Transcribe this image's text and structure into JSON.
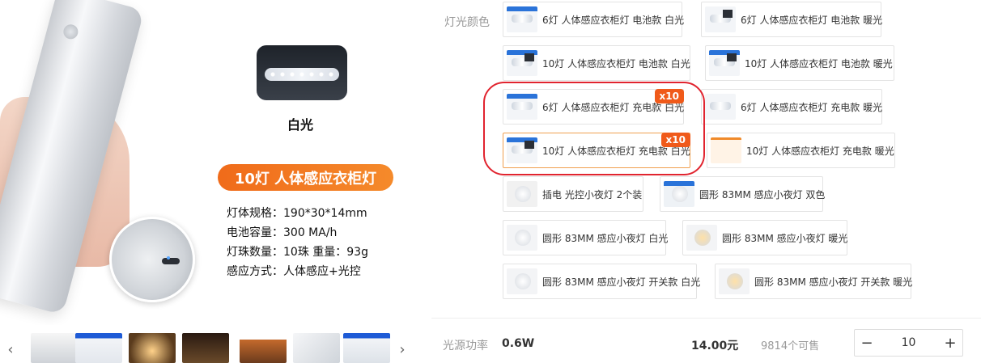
{
  "image_panel": {
    "caption": "白光",
    "title": "10灯 人体感应衣柜灯",
    "specs": [
      "灯体规格：190*30*14mm",
      "电池容量：300 MA/h",
      "灯珠数量：10珠     重量：93g",
      "感应方式：人体感应+光控"
    ]
  },
  "thumbnails": {
    "prev_glyph": "‹",
    "next_glyph": "›",
    "items": [
      {
        "label": ""
      },
      {
        "label": ""
      },
      {
        "label": ""
      },
      {
        "label": ""
      },
      {
        "label": ""
      },
      {
        "label": ""
      },
      {
        "label": ""
      }
    ]
  },
  "options": {
    "color_label": "灯光颜色",
    "items": [
      {
        "text": "6灯 人体感应衣柜灯 电池款 白光"
      },
      {
        "text": "6灯 人体感应衣柜灯 电池款 暖光"
      },
      {
        "text": "10灯 人体感应衣柜灯 电池款 白光"
      },
      {
        "text": "10灯 人体感应衣柜灯 电池款 暖光"
      },
      {
        "text": "6灯 人体感应衣柜灯 充电款 白光",
        "badge": "x10"
      },
      {
        "text": "6灯 人体感应衣柜灯 充电款 暖光"
      },
      {
        "text": "10灯 人体感应衣柜灯 充电款 白光",
        "badge": "x10",
        "selected": true
      },
      {
        "text": "10灯 人体感应衣柜灯 充电款 暖光"
      },
      {
        "text": "插电 光控小夜灯 2个装"
      },
      {
        "text": "圆形 83MM 感应小夜灯 双色"
      },
      {
        "text": "圆形 83MM 感应小夜灯 白光"
      },
      {
        "text": "圆形 83MM 感应小夜灯 暖光"
      },
      {
        "text": "圆形 83MM 感应小夜灯 开关款 白光"
      },
      {
        "text": "圆形 83MM 感应小夜灯 开关款 暖光"
      }
    ]
  },
  "purchase": {
    "power_label": "光源功率",
    "power_value": "0.6W",
    "price": "14.00元",
    "stock": "9814个可售",
    "qty_minus": "−",
    "qty_value": "10",
    "qty_plus": "+"
  },
  "colors": {
    "accent_orange": "#f06b1a",
    "annotation_red": "#e1242f",
    "selected_border": "#f0a050"
  }
}
